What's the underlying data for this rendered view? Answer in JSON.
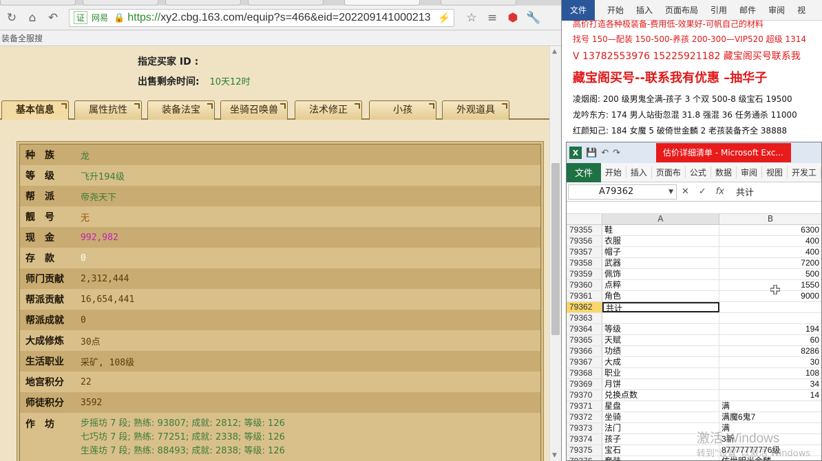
{
  "browser": {
    "url_host_label": "网易",
    "url_https": "https://",
    "url_rest": "xy2.cbg.163.com/equip?s=466&eid=202209141000213",
    "bookmark_text": "装备全服搜"
  },
  "listing": {
    "buyer_label": "指定买家 ID :",
    "buyer_value": "",
    "remaining_label": "出售剩余时间:",
    "remaining_value": "10天12时"
  },
  "tabs": [
    "基本信息",
    "属性抗性",
    "装备法宝",
    "坐骑召唤兽",
    "法术修正",
    "小孩",
    "外观道具"
  ],
  "info_rows": [
    {
      "label": "种　族",
      "value": "龙"
    },
    {
      "label": "等　级",
      "value": "飞升194级"
    },
    {
      "label": "帮　派",
      "value": "帝尧天下"
    },
    {
      "label": "靓　号",
      "value": "无"
    },
    {
      "label": "现　金",
      "value": "992,982"
    },
    {
      "label": "存　款",
      "value": "0"
    },
    {
      "label": "师门贡献",
      "value": "2,312,444"
    },
    {
      "label": "帮派贡献",
      "value": "16,654,441"
    },
    {
      "label": "帮派成就",
      "value": "0"
    },
    {
      "label": "大成修炼",
      "value": "30点"
    },
    {
      "label": "生活职业",
      "value": "采矿, 108级"
    },
    {
      "label": "地宫积分",
      "value": "22"
    },
    {
      "label": "师徒积分",
      "value": "3592"
    }
  ],
  "workshop": {
    "label": "作　坊",
    "lines": [
      "步摇坊 7 段; 熟练: 93807; 成就: 2812; 等级: 126",
      "七巧坊 7 段; 熟练: 77251; 成就: 2338; 等级: 126",
      "生莲坊 7 段; 熟练: 88493; 成就: 2838; 等级: 126"
    ]
  },
  "word": {
    "file_label": "文件",
    "menu": [
      "开始",
      "插入",
      "页面布局",
      "引用",
      "邮件",
      "审阅",
      "视"
    ],
    "lines": [
      {
        "style": "red-s",
        "text": "高价打造各种极装备-费用低-效果好-可帆自己的材料"
      },
      {
        "style": "red-s",
        "text": "找号 150—配装 150-500-养孩 200-300—VIP520 超级 1314"
      },
      {
        "style": "red-m",
        "text": "V 13782553976    15225921182  藏宝阁买号联系我"
      },
      {
        "style": "red-l",
        "text": "藏宝阁买号--联系我有优惠 –抽华子"
      },
      {
        "style": "black",
        "text": "凌烟阁: 200 级男鬼全满-孩子 3 个双 500-8 级宝石 19500"
      },
      {
        "style": "black",
        "text": "龙吟东方: 174 男人站街忽混 31.8 强混 36 任务通杀 11000"
      },
      {
        "style": "black",
        "text": "红颜知己: 184 女魔 5 破倚世金麟 2 老孩装备齐全 38888"
      }
    ]
  },
  "excel": {
    "caption": "估价详细清单 - Microsoft Exc...",
    "file_label": "文件",
    "ribbon_tabs": [
      "开始",
      "插入",
      "页面布",
      "公式",
      "数据",
      "审阅",
      "视图",
      "开发工"
    ],
    "name_box": "A79362",
    "formula_value": "共计",
    "col_a": "A",
    "col_b": "B",
    "rows": [
      {
        "n": "79355",
        "a": "鞋",
        "b": "6300"
      },
      {
        "n": "79356",
        "a": "衣服",
        "b": "400"
      },
      {
        "n": "79357",
        "a": "帽子",
        "b": "400"
      },
      {
        "n": "79358",
        "a": "武器",
        "b": "7200"
      },
      {
        "n": "79359",
        "a": "佩饰",
        "b": "500"
      },
      {
        "n": "79360",
        "a": "点粹",
        "b": "1550"
      },
      {
        "n": "79361",
        "a": "角色",
        "b": "9000"
      },
      {
        "n": "79362",
        "a": "共计",
        "b": ""
      },
      {
        "n": "79363",
        "a": "",
        "b": ""
      },
      {
        "n": "79364",
        "a": "等级",
        "b": "194"
      },
      {
        "n": "79365",
        "a": "天赋",
        "b": "60"
      },
      {
        "n": "79366",
        "a": "功绩",
        "b": "8286"
      },
      {
        "n": "79367",
        "a": "大成",
        "b": "30"
      },
      {
        "n": "79368",
        "a": "职业",
        "b": "108"
      },
      {
        "n": "79369",
        "a": "月饼",
        "b": "34"
      },
      {
        "n": "79370",
        "a": "兑换点数",
        "b": "14"
      },
      {
        "n": "79371",
        "a": "星盘",
        "b": "满"
      },
      {
        "n": "79372",
        "a": "坐骑",
        "b": "满魔6鬼7"
      },
      {
        "n": "79373",
        "a": "法门",
        "b": "满"
      },
      {
        "n": "79374",
        "a": "孩子",
        "b": "3新"
      },
      {
        "n": "79375",
        "a": "宝石",
        "b": "87777777776级"
      },
      {
        "n": "79376",
        "a": "套装",
        "b": "仿世明光金麟"
      }
    ],
    "selected_row": "79362"
  },
  "watermark": {
    "line1": "激活 Windows",
    "line2": "转到\"设置\"以激活 Windows"
  }
}
